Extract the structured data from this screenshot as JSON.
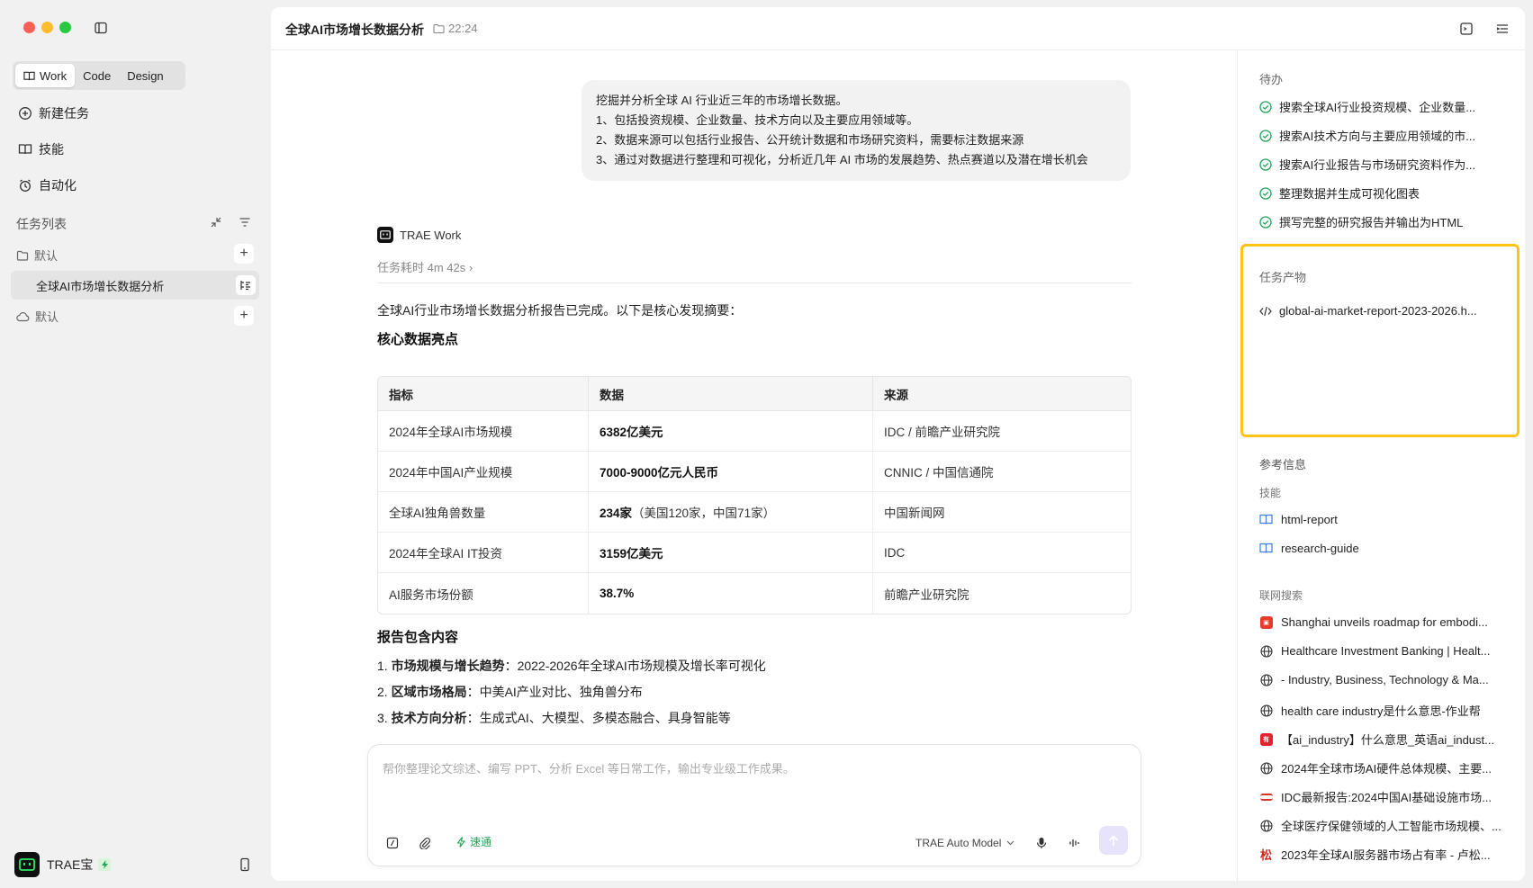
{
  "sidebar": {
    "modes": [
      "Work",
      "Code",
      "Design"
    ],
    "nav": [
      "新建任务",
      "技能",
      "自动化"
    ],
    "task_list_label": "任务列表",
    "group1": "默认",
    "task_item": "全球AI市场增长数据分析",
    "group2": "默认",
    "user_name": "TRAE宝"
  },
  "header": {
    "title": "全球AI市场增长数据分析",
    "time": "22:24"
  },
  "chat": {
    "user_message": [
      "挖掘并分析全球 AI 行业近三年的市场增长数据。",
      "1、包括投资规模、企业数量、技术方向以及主要应用领域等。",
      "2、数据来源可以包括行业报告、公开统计数据和市场研究资料，需要标注数据来源",
      "3、通过对数据进行整理和可视化，分析近几年 AI 市场的发展趋势、热点赛道以及潜在增长机会"
    ],
    "agent_name": "TRAE Work",
    "duration": "任务耗时 4m 42s ›",
    "summary": "全球AI行业市场增长数据分析报告已完成。以下是核心发现摘要：",
    "heading1": "核心数据亮点",
    "table": {
      "headers": [
        "指标",
        "数据",
        "来源"
      ],
      "rows": [
        {
          "metric": "2024年全球AI市场规模",
          "value": "6382亿美元",
          "extra": "",
          "source": "IDC / 前瞻产业研究院"
        },
        {
          "metric": "2024年中国AI产业规模",
          "value": "7000-9000亿元人民币",
          "extra": "",
          "source": "CNNIC / 中国信通院"
        },
        {
          "metric": "全球AI独角兽数量",
          "value": "234家",
          "extra": "（美国120家，中国71家）",
          "source": "中国新闻网"
        },
        {
          "metric": "2024年全球AI IT投资",
          "value": "3159亿美元",
          "extra": "",
          "source": "IDC"
        },
        {
          "metric": "AI服务市场份额",
          "value": "38.7%",
          "extra": "",
          "source": "前瞻产业研究院"
        }
      ]
    },
    "heading2": "报告包含内容",
    "items": [
      {
        "num": "1.",
        "bold": "市场规模与增长趋势",
        "rest": "：2022-2026年全球AI市场规模及增长率可视化"
      },
      {
        "num": "2.",
        "bold": "区域市场格局",
        "rest": "：中美AI产业对比、独角兽分布"
      },
      {
        "num": "3.",
        "bold": "技术方向分析",
        "rest": "：生成式AI、大模型、多模态融合、具身智能等"
      }
    ]
  },
  "composer": {
    "placeholder": "帮你整理论文综述、编写 PPT、分析 Excel 等日常工作，输出专业级工作成果。",
    "speed_label": "速通",
    "model_label": "TRAE Auto Model"
  },
  "right_panel": {
    "todo_label": "待办",
    "todos": [
      "搜索全球AI行业投资规模、企业数量...",
      "搜索AI技术方向与主要应用领域的市...",
      "搜索AI行业报告与市场研究资料作为...",
      "整理数据并生成可视化图表",
      "撰写完整的研究报告并输出为HTML"
    ],
    "artifacts_label": "任务产物",
    "artifact_file": "global-ai-market-report-2023-2026.h...",
    "ref_label": "参考信息",
    "skills_label": "技能",
    "skills": [
      "html-report",
      "research-guide"
    ],
    "web_label": "联网搜索",
    "web_results": [
      {
        "title": "Shanghai unveils roadmap for embodi...",
        "icon": "news-favicon",
        "color": "#e8392f"
      },
      {
        "title": "Healthcare Investment Banking | Healt...",
        "icon": "globe-icon",
        "color": ""
      },
      {
        "title": "- Industry, Business, Technology & Ma...",
        "icon": "globe-icon",
        "color": ""
      },
      {
        "title": "health care industry是什么意思-作业帮",
        "icon": "globe-icon",
        "color": ""
      },
      {
        "title": "【ai_industry】什么意思_英语ai_indust...",
        "icon": "dict-favicon",
        "color": "#e5202f"
      },
      {
        "title": "2024年全球市场AI硬件总体规模、主要...",
        "icon": "globe-icon",
        "color": ""
      },
      {
        "title": "IDC最新报告:2024中国AI基础设施市场...",
        "icon": "idc-favicon",
        "color": "#d9322b"
      },
      {
        "title": "全球医疗保健领域的人工智能市场规模、...",
        "icon": "globe-icon",
        "color": ""
      },
      {
        "title": "2023年全球AI服务器市场占有率 - 卢松...",
        "icon": "song-favicon",
        "color": "#d0271d"
      }
    ]
  },
  "colors": {
    "accent_green": "#22a559",
    "highlight_yellow": "#fcc419",
    "send_button": "#e6e3fb"
  }
}
